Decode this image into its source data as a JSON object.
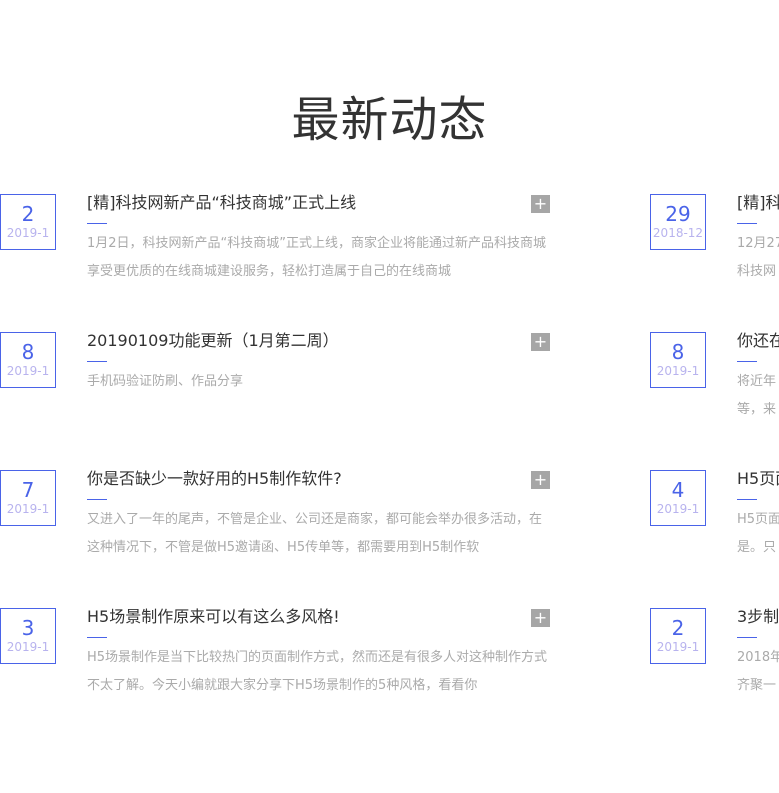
{
  "heading": "最新动态",
  "left": [
    {
      "day": "2",
      "ym": "2019-1",
      "title": "[精]科技网新产品“科技商城”正式上线",
      "desc": "1月2日，科技网新产品“科技商城”正式上线，商家企业将能通过新产品科技商城享受更优质的在线商城建设服务，轻松打造属于自己的在线商城"
    },
    {
      "day": "8",
      "ym": "2019-1",
      "title": "20190109功能更新（1月第二周）",
      "desc": "手机码验证防刷、作品分享"
    },
    {
      "day": "7",
      "ym": "2019-1",
      "title": "你是否缺少一款好用的H5制作软件?",
      "desc": "又进入了一年的尾声，不管是企业、公司还是商家，都可能会举办很多活动，在这种情况下，不管是做H5邀请函、H5传单等，都需要用到H5制作软"
    },
    {
      "day": "3",
      "ym": "2019-1",
      "title": "H5场景制作原来可以有这么多风格!",
      "desc": "H5场景制作是当下比较热门的页面制作方式，然而还是有很多人对这种制作方式不太了解。今天小编就跟大家分享下H5场景制作的5种风格，看看你"
    }
  ],
  "right": [
    {
      "day": "29",
      "ym": "2018-12",
      "title": "[精]科",
      "desc1": "12月27",
      "desc2": "科技网"
    },
    {
      "day": "8",
      "ym": "2019-1",
      "title": "你还在",
      "desc1": "将近年",
      "desc2": "等，来"
    },
    {
      "day": "4",
      "ym": "2019-1",
      "title": "H5页面",
      "desc1": "H5页面",
      "desc2": "是。只"
    },
    {
      "day": "2",
      "ym": "2019-1",
      "title": "3步制",
      "desc1": "2018年",
      "desc2": "齐聚一"
    }
  ],
  "plus_icon": "+",
  "accent": "#4a63e8"
}
